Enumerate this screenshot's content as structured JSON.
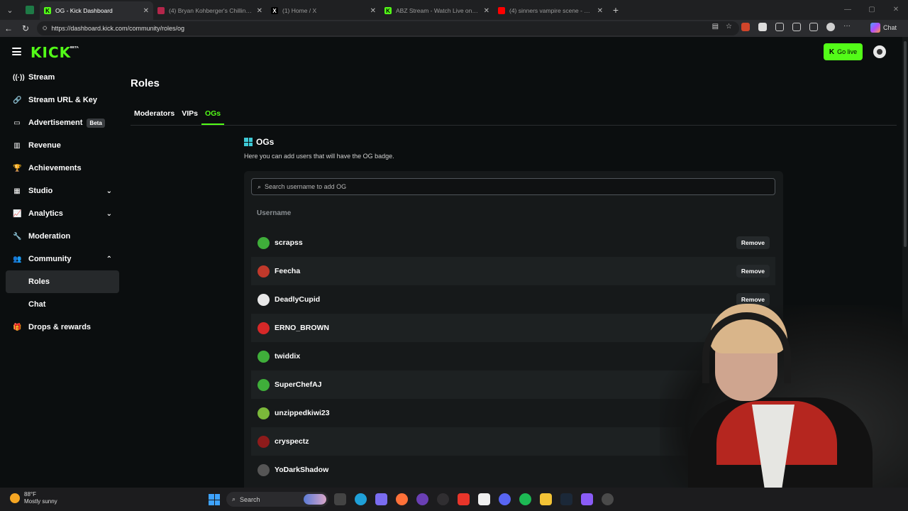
{
  "browser": {
    "tabs": [
      {
        "label": "OG - Kick Dashboard",
        "active": true,
        "favicon_color": "#53fc18",
        "favicon_letter": "K"
      },
      {
        "label": "(4) Bryan Kohberger's Chilling Mu...",
        "active": false,
        "favicon_color": "#b3264a",
        "favicon_letter": ""
      },
      {
        "label": "(1) Home / X",
        "active": false,
        "favicon_color": "#000000",
        "favicon_letter": "X"
      },
      {
        "label": "ABZ Stream - Watch Live on Kick",
        "active": false,
        "favicon_color": "#53fc18",
        "favicon_letter": "K"
      },
      {
        "label": "(4) sinners vampire scene - YouTu...",
        "active": false,
        "favicon_color": "#ff0000",
        "favicon_letter": ""
      }
    ],
    "url": "https://dashboard.kick.com/community/roles/og",
    "chat_label": "Chat"
  },
  "app": {
    "logo": "KICK",
    "logo_badge": "BETA",
    "go_live_label": "Go live",
    "accent": "#53fc18"
  },
  "sidebar": {
    "items": [
      {
        "label": "Stream",
        "icon": "broadcast-icon",
        "glyph": "((·))"
      },
      {
        "label": "Stream URL & Key",
        "icon": "link-icon",
        "glyph": "🔗"
      },
      {
        "label": "Advertisement",
        "icon": "tv-icon",
        "glyph": "▭",
        "badge": "Beta"
      },
      {
        "label": "Revenue",
        "icon": "chart-icon",
        "glyph": "▥"
      },
      {
        "label": "Achievements",
        "icon": "trophy-icon",
        "glyph": "🏆"
      },
      {
        "label": "Studio",
        "icon": "studio-icon",
        "glyph": "▦",
        "chevron": "down"
      },
      {
        "label": "Analytics",
        "icon": "analytics-icon",
        "glyph": "📈",
        "chevron": "down"
      },
      {
        "label": "Moderation",
        "icon": "wrench-icon",
        "glyph": "🔧"
      },
      {
        "label": "Community",
        "icon": "community-icon",
        "glyph": "👥",
        "chevron": "up"
      },
      {
        "label": "Roles",
        "sub": true,
        "active": true
      },
      {
        "label": "Chat",
        "sub": true
      },
      {
        "label": "Drops & rewards",
        "icon": "gift-icon",
        "glyph": "🎁"
      }
    ]
  },
  "page": {
    "title": "Roles",
    "tabs": [
      {
        "label": "Moderators",
        "active": false
      },
      {
        "label": "VIPs",
        "active": false
      },
      {
        "label": "OGs",
        "active": true
      }
    ],
    "section_title": "OGs",
    "section_desc": "Here you can add users that will have the OG badge.",
    "search_placeholder": "Search username to add OG",
    "column_header": "Username",
    "remove_label": "Remove",
    "users": [
      {
        "name": "scrapss",
        "avatar_color": "#3fae3a",
        "show_remove": true
      },
      {
        "name": "Feecha",
        "avatar_color": "#c0392b",
        "show_remove": true
      },
      {
        "name": "DeadlyCupid",
        "avatar_color": "#e8e8e8",
        "show_remove": true
      },
      {
        "name": "ERNO_BROWN",
        "avatar_color": "#d62828",
        "show_remove": false
      },
      {
        "name": "twiddix",
        "avatar_color": "#3fae3a",
        "show_remove": false
      },
      {
        "name": "SuperChefAJ",
        "avatar_color": "#3fae3a",
        "show_remove": false
      },
      {
        "name": "unzippedkiwi23",
        "avatar_color": "#7bb83a",
        "show_remove": false
      },
      {
        "name": "cryspectz",
        "avatar_color": "#8e1b1b",
        "show_remove": false
      },
      {
        "name": "YoDarkShadow",
        "avatar_color": "#555555",
        "show_remove": false
      }
    ]
  },
  "taskbar": {
    "temperature": "88°F",
    "condition": "Mostly sunny",
    "search_label": "Search"
  }
}
